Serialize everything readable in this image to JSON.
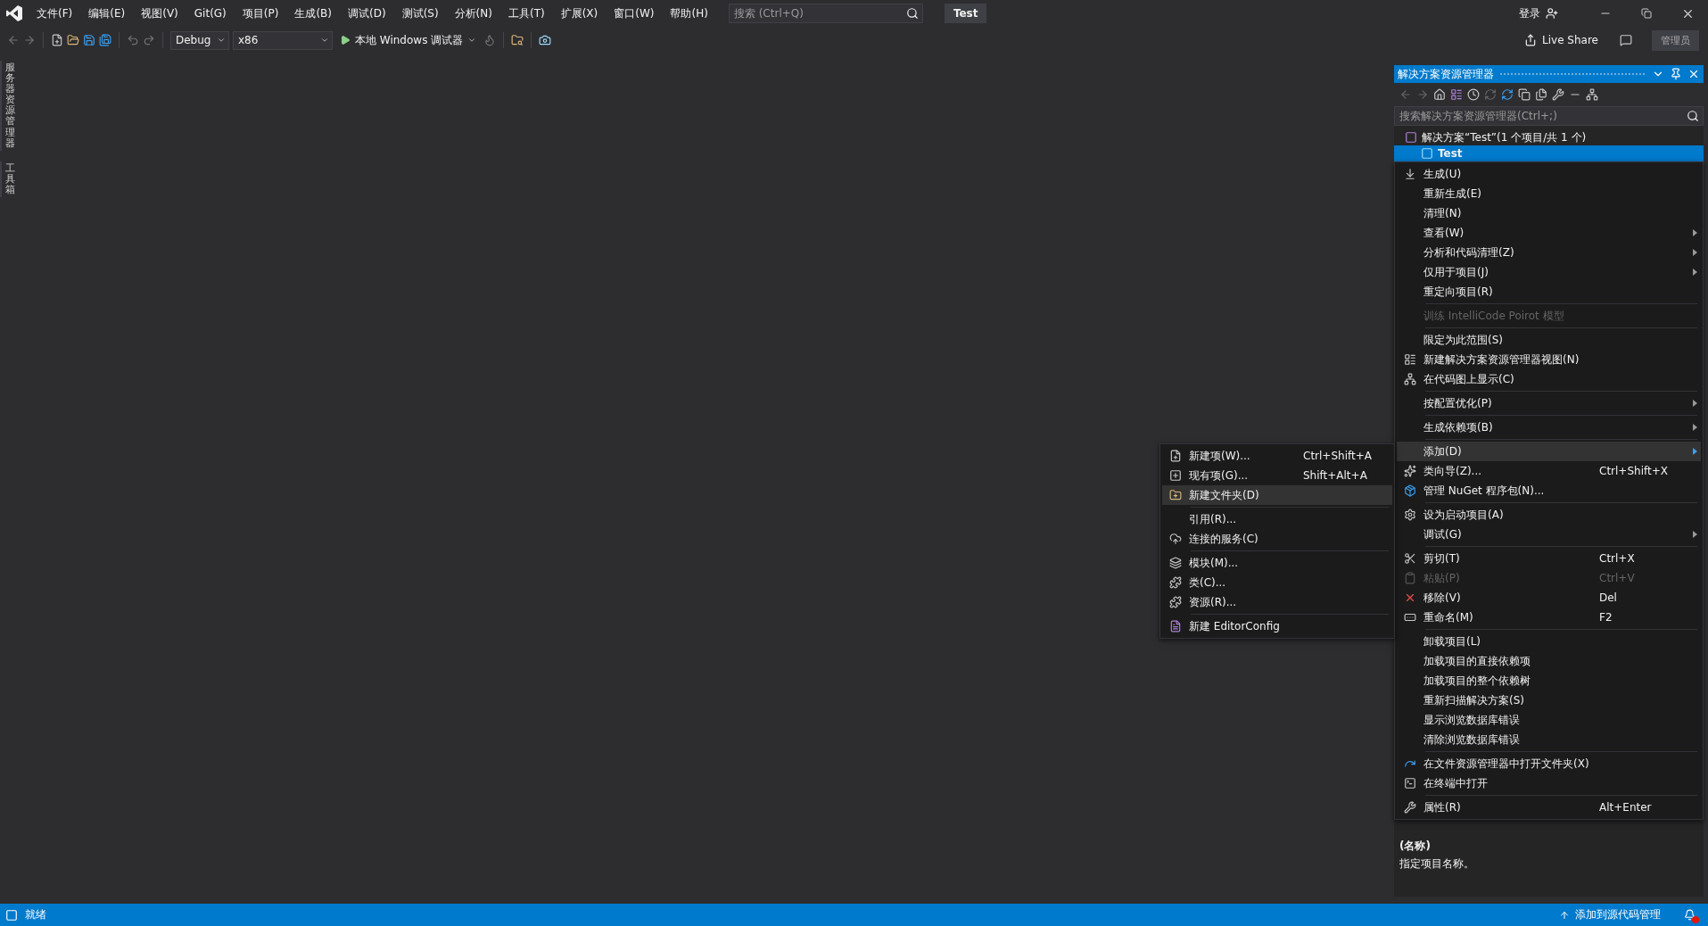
{
  "title_bar": {
    "menu": [
      "文件(F)",
      "编辑(E)",
      "视图(V)",
      "Git(G)",
      "项目(P)",
      "生成(B)",
      "调试(D)",
      "测试(S)",
      "分析(N)",
      "工具(T)",
      "扩展(X)",
      "窗口(W)",
      "帮助(H)"
    ],
    "search": {
      "placeholder": "搜索 (Ctrl+Q)"
    },
    "solution_name": "Test",
    "sign_in": "登录"
  },
  "toolbar": {
    "configuration": "Debug",
    "platform": "x86",
    "run": "本地 Windows 调试器",
    "live_share": "Live Share",
    "role": "管理员"
  },
  "side_tabs": [
    "服务器资源管理器",
    "工具箱"
  ],
  "solution_explorer": {
    "title": "解决方案资源管理器",
    "search": {
      "placeholder": "搜索解决方案资源管理器(Ctrl+;)"
    },
    "tree": [
      {
        "label": "解决方案“Test”(1 个项目/共 1 个)",
        "selected": false,
        "children": [
          {
            "label": "Test",
            "selected": true
          }
        ]
      }
    ],
    "properties": {
      "name": "(名称)",
      "description": "指定项目名称。"
    }
  },
  "context_menu": {
    "items": [
      {
        "kind": "item",
        "label": "生成(U)",
        "selected": false,
        "disabled": false,
        "has_submenu": false
      },
      {
        "kind": "item",
        "label": "重新生成(E)",
        "selected": false,
        "disabled": false,
        "has_submenu": false
      },
      {
        "kind": "item",
        "label": "清理(N)",
        "selected": false,
        "disabled": false,
        "has_submenu": false
      },
      {
        "kind": "item",
        "label": "查看(W)",
        "selected": false,
        "disabled": false,
        "has_submenu": true
      },
      {
        "kind": "item",
        "label": "分析和代码清理(Z)",
        "selected": false,
        "disabled": false,
        "has_submenu": true
      },
      {
        "kind": "item",
        "label": "仅用于项目(J)",
        "selected": false,
        "disabled": false,
        "has_submenu": true
      },
      {
        "kind": "item",
        "label": "重定向项目(R)",
        "selected": false,
        "disabled": false,
        "has_submenu": false
      },
      {
        "kind": "separator"
      },
      {
        "kind": "item",
        "label": "训练 IntelliCode Poirot 模型",
        "selected": false,
        "disabled": true,
        "has_submenu": false
      },
      {
        "kind": "separator"
      },
      {
        "kind": "item",
        "label": "限定为此范围(S)",
        "selected": false,
        "disabled": false,
        "has_submenu": false
      },
      {
        "kind": "item",
        "label": "新建解决方案资源管理器视图(N)",
        "selected": false,
        "disabled": false,
        "has_submenu": false
      },
      {
        "kind": "item",
        "label": "在代码图上显示(C)",
        "selected": false,
        "disabled": false,
        "has_submenu": false
      },
      {
        "kind": "separator"
      },
      {
        "kind": "item",
        "label": "按配置优化(P)",
        "selected": false,
        "disabled": false,
        "has_submenu": true
      },
      {
        "kind": "separator"
      },
      {
        "kind": "item",
        "label": "生成依赖项(B)",
        "selected": false,
        "disabled": false,
        "has_submenu": true
      },
      {
        "kind": "separator"
      },
      {
        "kind": "item",
        "label": "添加(D)",
        "selected": true,
        "disabled": false,
        "has_submenu": true
      },
      {
        "kind": "item",
        "label": "类向导(Z)...",
        "shortcut": "Ctrl+Shift+X",
        "selected": false,
        "disabled": false,
        "has_submenu": false
      },
      {
        "kind": "item",
        "label": "管理 NuGet 程序包(N)...",
        "selected": false,
        "disabled": false,
        "has_submenu": false
      },
      {
        "kind": "separator"
      },
      {
        "kind": "item",
        "label": "设为启动项目(A)",
        "selected": false,
        "disabled": false,
        "has_submenu": false
      },
      {
        "kind": "item",
        "label": "调试(G)",
        "selected": false,
        "disabled": false,
        "has_submenu": true
      },
      {
        "kind": "separator"
      },
      {
        "kind": "item",
        "label": "剪切(T)",
        "shortcut": "Ctrl+X",
        "selected": false,
        "disabled": false,
        "has_submenu": false
      },
      {
        "kind": "item",
        "label": "粘贴(P)",
        "shortcut": "Ctrl+V",
        "selected": false,
        "disabled": true,
        "has_submenu": false
      },
      {
        "kind": "item",
        "label": "移除(V)",
        "shortcut": "Del",
        "selected": false,
        "disabled": false,
        "has_submenu": false
      },
      {
        "kind": "item",
        "label": "重命名(M)",
        "shortcut": "F2",
        "selected": false,
        "disabled": false,
        "has_submenu": false
      },
      {
        "kind": "separator"
      },
      {
        "kind": "item",
        "label": "卸载项目(L)",
        "selected": false,
        "disabled": false,
        "has_submenu": false
      },
      {
        "kind": "item",
        "label": "加载项目的直接依赖项",
        "selected": false,
        "disabled": false,
        "has_submenu": false
      },
      {
        "kind": "item",
        "label": "加载项目的整个依赖树",
        "selected": false,
        "disabled": false,
        "has_submenu": false
      },
      {
        "kind": "item",
        "label": "重新扫描解决方案(S)",
        "selected": false,
        "disabled": false,
        "has_submenu": false
      },
      {
        "kind": "item",
        "label": "显示浏览数据库错误",
        "selected": false,
        "disabled": false,
        "has_submenu": false
      },
      {
        "kind": "item",
        "label": "清除浏览数据库错误",
        "selected": false,
        "disabled": false,
        "has_submenu": false
      },
      {
        "kind": "separator"
      },
      {
        "kind": "item",
        "label": "在文件资源管理器中打开文件夹(X)",
        "selected": false,
        "disabled": false,
        "has_submenu": false
      },
      {
        "kind": "item",
        "label": "在终端中打开",
        "selected": false,
        "disabled": false,
        "has_submenu": false
      },
      {
        "kind": "separator"
      },
      {
        "kind": "item",
        "label": "属性(R)",
        "shortcut": "Alt+Enter",
        "selected": false,
        "disabled": false,
        "has_submenu": false
      }
    ]
  },
  "add_submenu": {
    "items": [
      {
        "kind": "item",
        "label": "新建项(W)...",
        "shortcut": "Ctrl+Shift+A",
        "selected": false,
        "disabled": false
      },
      {
        "kind": "item",
        "label": "现有项(G)...",
        "shortcut": "Shift+Alt+A",
        "selected": false,
        "disabled": false
      },
      {
        "kind": "item",
        "label": "新建文件夹(D)",
        "selected": true,
        "disabled": false
      },
      {
        "kind": "separator"
      },
      {
        "kind": "item",
        "label": "引用(R)...",
        "selected": false,
        "disabled": false
      },
      {
        "kind": "item",
        "label": "连接的服务(C)",
        "selected": false,
        "disabled": false
      },
      {
        "kind": "separator"
      },
      {
        "kind": "item",
        "label": "模块(M)...",
        "selected": false,
        "disabled": false
      },
      {
        "kind": "item",
        "label": "类(C)...",
        "selected": false,
        "disabled": false
      },
      {
        "kind": "item",
        "label": "资源(R)...",
        "selected": false,
        "disabled": false
      },
      {
        "kind": "separator"
      },
      {
        "kind": "item",
        "label": "新建 EditorConfig",
        "selected": false,
        "disabled": false
      }
    ]
  },
  "status_bar": {
    "status": "就绪",
    "source_control": "添加到源代码管理"
  }
}
